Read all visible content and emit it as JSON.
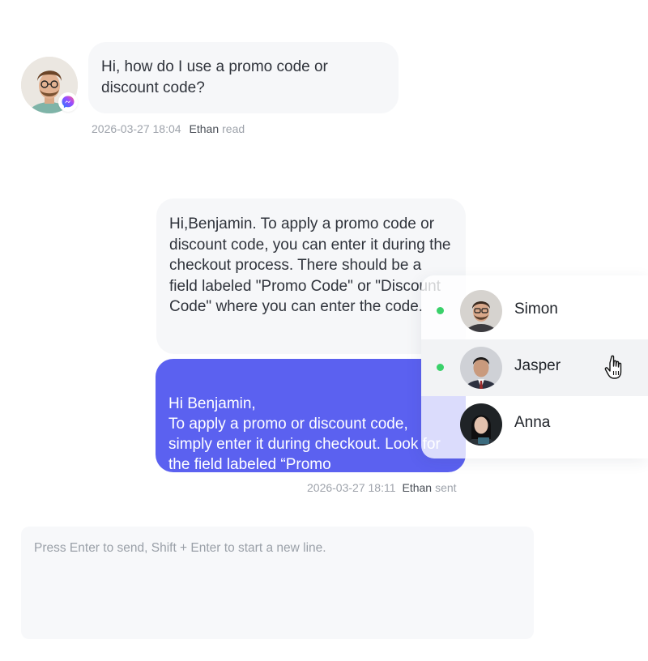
{
  "incoming": {
    "text": "Hi, how do I use a promo code or discount code?",
    "timestamp": "2026-03-27 18:04",
    "agent": "Ethan",
    "status": "read",
    "channel_icon": "messenger-icon"
  },
  "reply_draft": {
    "text": "Hi,Benjamin. To apply a promo code or discount code, you can enter it during the checkout process. There should be a field labeled \"Promo Code\" or \"Discount Code\" where you can enter the code."
  },
  "outgoing": {
    "text": "Hi Benjamin,\nTo apply a promo or discount code, simply enter it during checkout. Look for the field labeled “Promo",
    "timestamp": "2026-03-27 18:11",
    "agent": "Ethan",
    "status": "sent",
    "color": "#5b61f0"
  },
  "mention_list": {
    "items": [
      {
        "name": "Simon",
        "online": true
      },
      {
        "name": "Jasper",
        "online": true,
        "hovered": true
      },
      {
        "name": "Anna",
        "online": false
      }
    ],
    "online_color": "#3ad16a"
  },
  "composer": {
    "placeholder": "Press Enter to send,  Shift + Enter to start a new line."
  }
}
